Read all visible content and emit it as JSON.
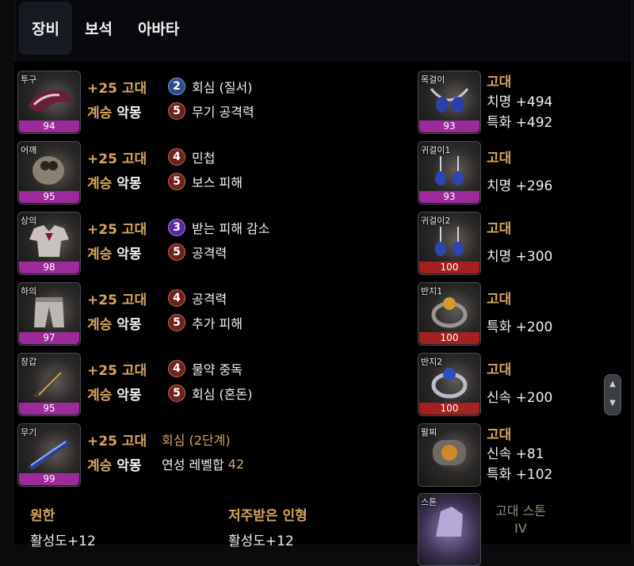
{
  "tabs": [
    "장비",
    "보석",
    "아바타"
  ],
  "gear": [
    {
      "slot": "투구",
      "quality": "94",
      "enhance": "+25 고대",
      "succ1": "계승",
      "succ2": "악몽",
      "effects": [
        {
          "level": "2",
          "color": "blue",
          "text": "회심 (질서)"
        },
        {
          "level": "5",
          "color": "red",
          "text": "무기 공격력"
        }
      ]
    },
    {
      "slot": "어깨",
      "quality": "95",
      "enhance": "+25 고대",
      "succ1": "계승",
      "succ2": "악몽",
      "effects": [
        {
          "level": "4",
          "color": "red",
          "text": "민첩"
        },
        {
          "level": "5",
          "color": "red",
          "text": "보스 피해"
        }
      ]
    },
    {
      "slot": "상의",
      "quality": "98",
      "enhance": "+25 고대",
      "succ1": "계승",
      "succ2": "악몽",
      "effects": [
        {
          "level": "3",
          "color": "purple",
          "text": "받는 피해 감소"
        },
        {
          "level": "5",
          "color": "red",
          "text": "공격력"
        }
      ]
    },
    {
      "slot": "하의",
      "quality": "97",
      "enhance": "+25 고대",
      "succ1": "계승",
      "succ2": "악몽",
      "effects": [
        {
          "level": "4",
          "color": "red",
          "text": "공격력"
        },
        {
          "level": "5",
          "color": "red",
          "text": "추가 피해"
        }
      ]
    },
    {
      "slot": "장갑",
      "quality": "95",
      "enhance": "+25 고대",
      "succ1": "계승",
      "succ2": "악몽",
      "effects": [
        {
          "level": "4",
          "color": "red",
          "text": "물약 중독"
        },
        {
          "level": "5",
          "color": "red",
          "text": "회심 (혼돈)"
        }
      ]
    }
  ],
  "weapon": {
    "slot": "무기",
    "quality": "99",
    "enhance": "+25 고대",
    "succ1": "계승",
    "succ2": "악몽",
    "line1": "회심 (2단계)",
    "line2_prefix": "연성 레벨합",
    "line2_value": "42"
  },
  "accessories": [
    {
      "slot": "목걸이",
      "quality": "93",
      "qcolor": "purple",
      "title": "고대",
      "stats": [
        "치명 +494",
        "특화 +492"
      ]
    },
    {
      "slot": "귀걸이1",
      "quality": "93",
      "qcolor": "purple",
      "title": "고대",
      "stats": [
        "치명 +296"
      ]
    },
    {
      "slot": "귀걸이2",
      "quality": "100",
      "qcolor": "red",
      "title": "고대",
      "stats": [
        "치명 +300"
      ]
    },
    {
      "slot": "반지1",
      "quality": "100",
      "qcolor": "red",
      "title": "고대",
      "stats": [
        "특화 +200"
      ]
    },
    {
      "slot": "반지2",
      "quality": "100",
      "qcolor": "red",
      "title": "고대",
      "stats": [
        "신속 +200"
      ]
    },
    {
      "slot": "팔찌",
      "quality": "",
      "qcolor": "purple",
      "title": "고대",
      "stats": [
        "신속 +81",
        "특화 +102"
      ]
    }
  ],
  "stone": {
    "slot": "스톤",
    "name_line1": "고대 스톤",
    "name_line2": "IV"
  },
  "bottom": [
    {
      "label": "원한",
      "value": "활성도+12"
    },
    {
      "label": "저주받은 인형",
      "value": "활성도+12"
    }
  ],
  "colors": {
    "gold": "#d7a65c",
    "quality_purple": "#9c2a9a",
    "quality_red": "#a5211f",
    "badge_blue": "#2b4d8c",
    "badge_red": "#6d221c",
    "badge_purple": "#5a2aa0"
  }
}
